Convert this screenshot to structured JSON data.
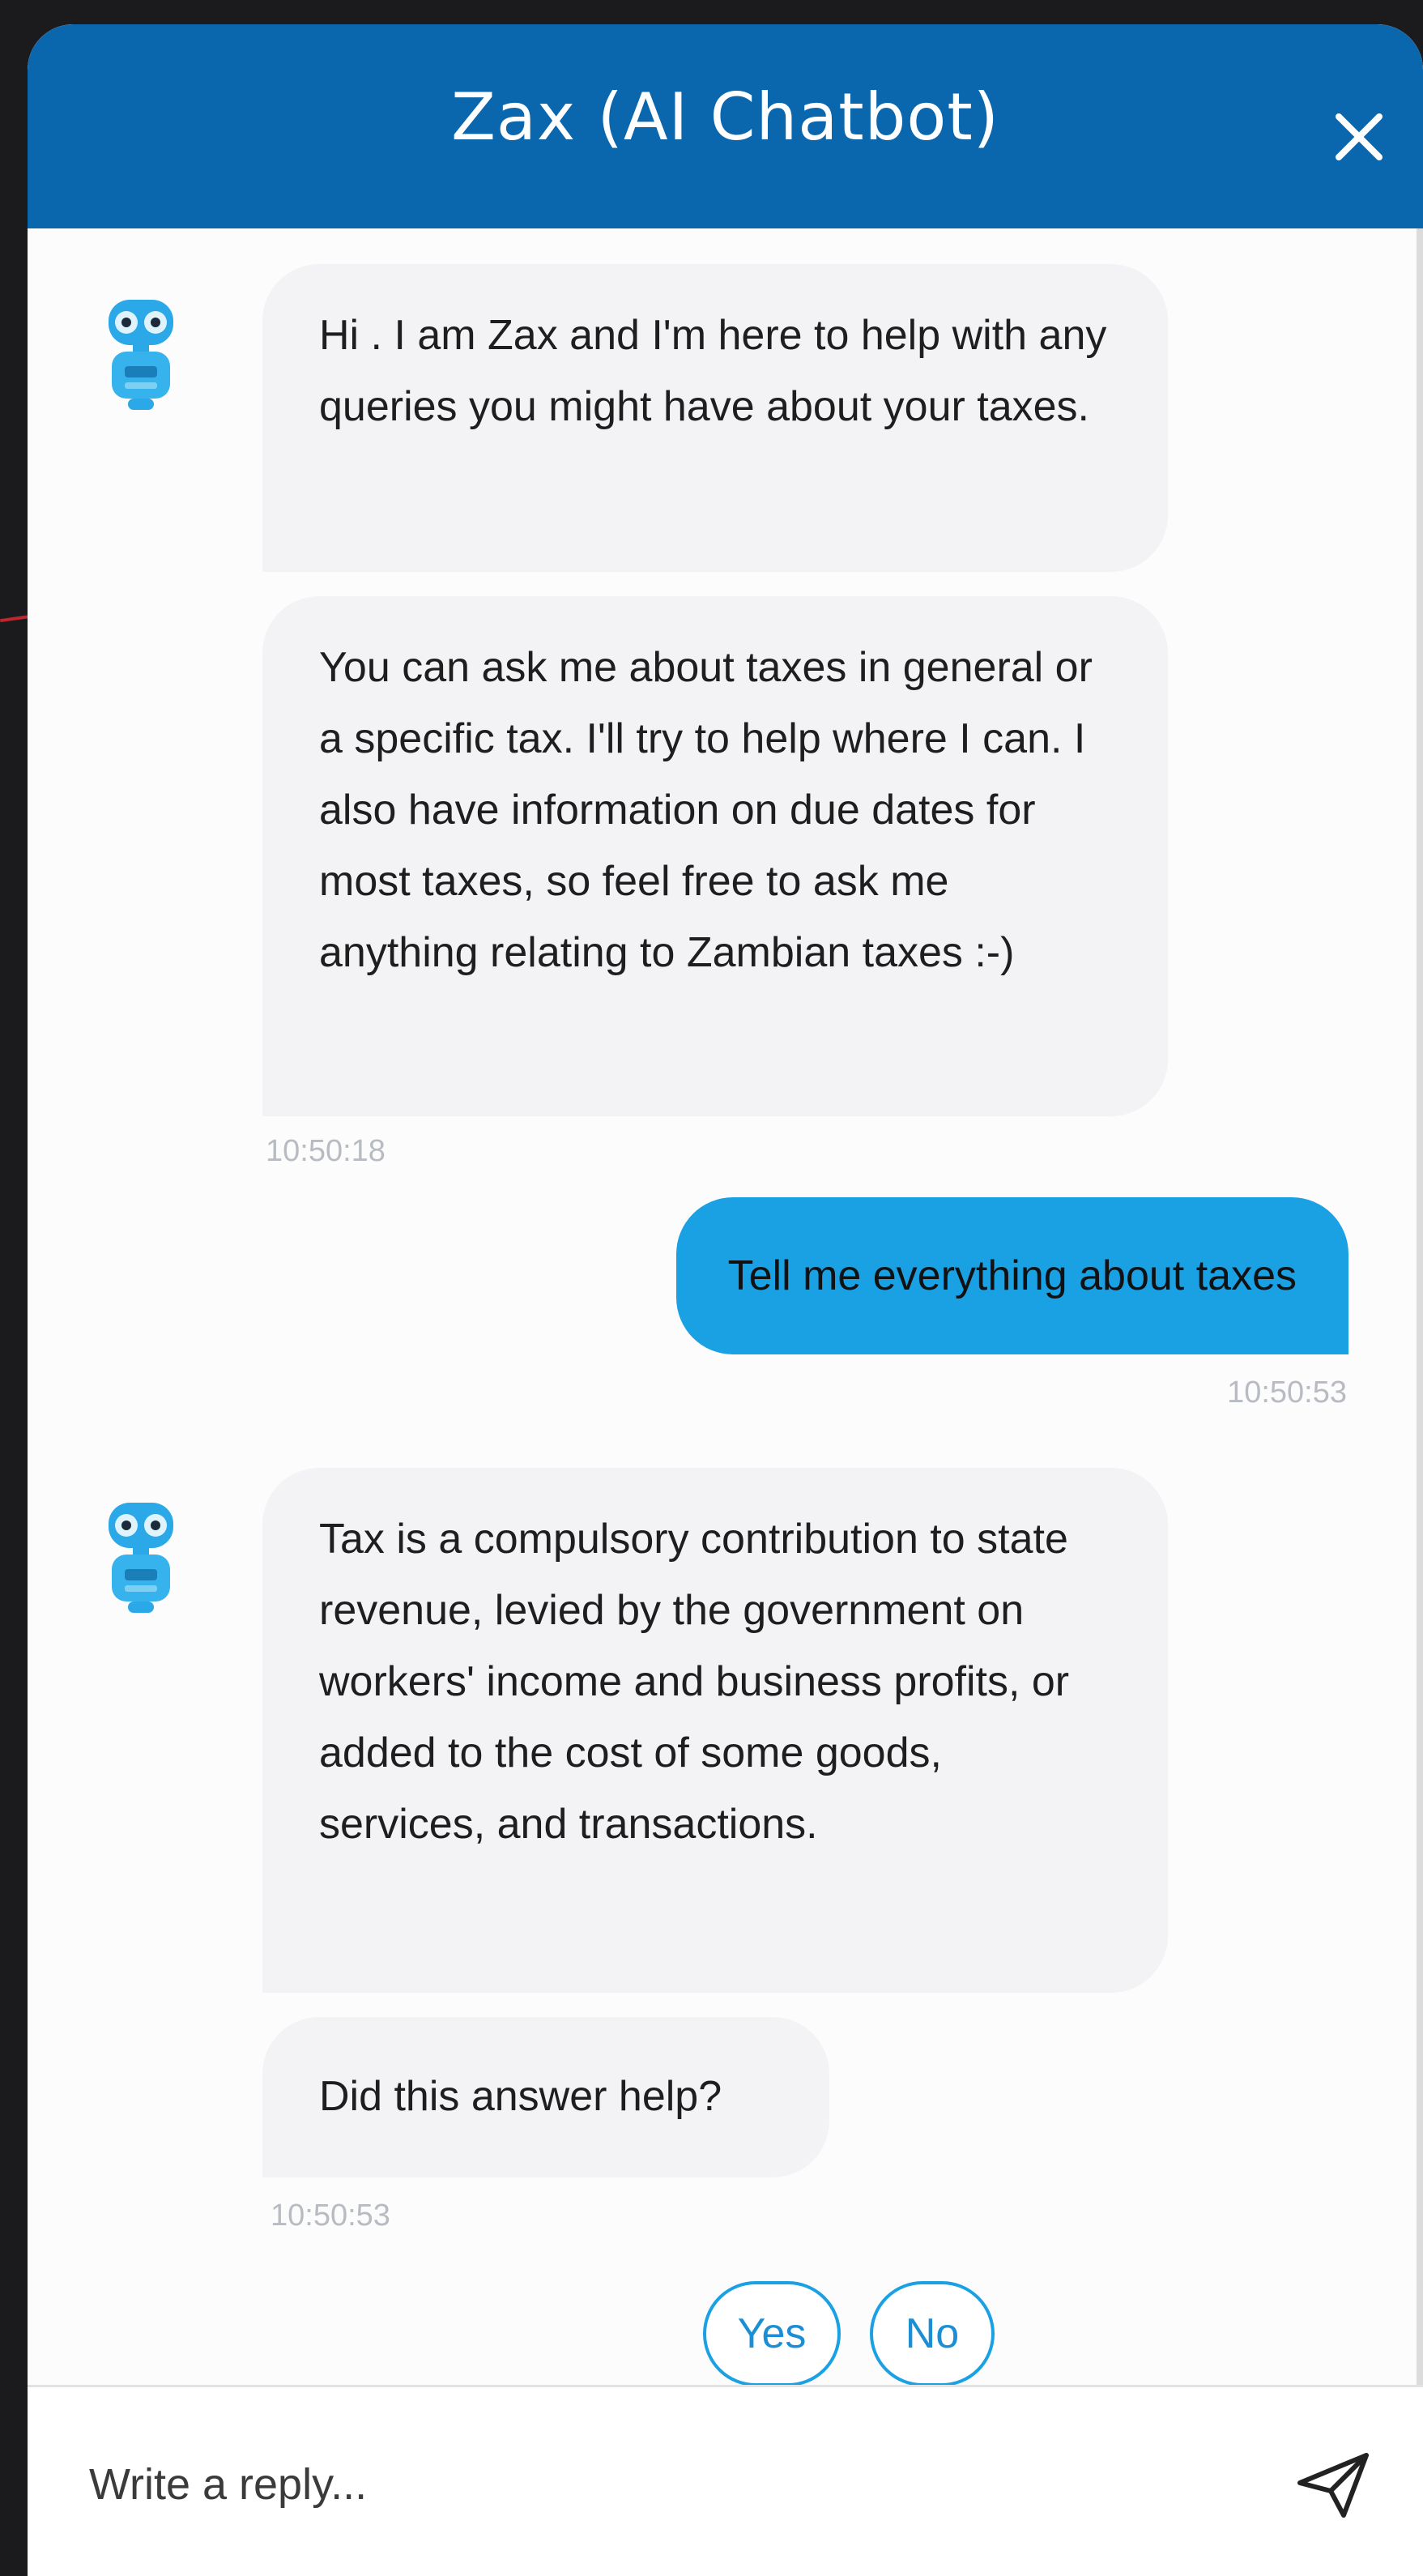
{
  "header": {
    "title": "Zax (AI Chatbot)",
    "close_icon": "close-icon"
  },
  "messages": [
    {
      "sender": "bot",
      "text": "Hi . I am Zax and I'm here to help with any queries you might have about your taxes."
    },
    {
      "sender": "bot",
      "text": "You can ask me about taxes in general or a specific tax. I'll try to help where I can. I also have information on due dates for most taxes, so feel free to ask me anything relating to Zambian taxes :-)",
      "time": "10:50:18"
    },
    {
      "sender": "user",
      "text": "Tell me everything about taxes",
      "time": "10:50:53"
    },
    {
      "sender": "bot",
      "text": "Tax is a compulsory contribution to state revenue, levied by the government on workers' income and business profits, or added to the cost of some goods, services, and transactions."
    },
    {
      "sender": "bot",
      "text": "Did this answer help?",
      "time": "10:50:53"
    }
  ],
  "quick_replies": [
    {
      "label": "Yes"
    },
    {
      "label": "No"
    }
  ],
  "composer": {
    "placeholder": "Write a reply...",
    "send_icon": "send-icon"
  },
  "colors": {
    "header": "#0a67ae",
    "user_bubble": "#1aa1e4",
    "bot_bubble": "#f3f3f5",
    "timestamp": "#b8bcc2"
  }
}
